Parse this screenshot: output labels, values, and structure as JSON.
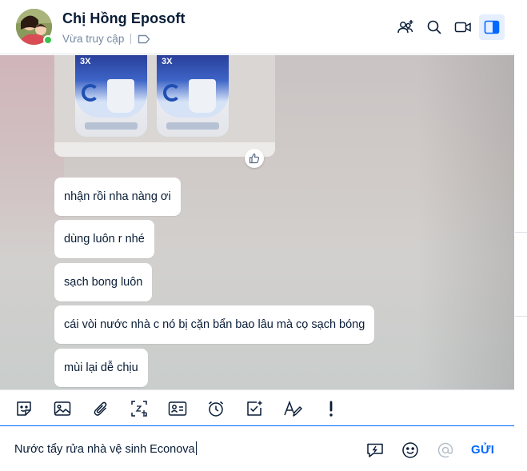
{
  "header": {
    "contact_name": "Chị Hồng Eposoft",
    "status": "Vừa truy cập",
    "icons": [
      "add-member-icon",
      "search-icon",
      "video-call-icon",
      "sidebar-toggle-icon"
    ]
  },
  "chat": {
    "image_message": {
      "bottle_badge": "3X"
    },
    "messages": [
      "nhận rồi nha nàng ơi",
      "dùng luôn r nhé",
      "sạch bong luôn",
      "cái vòi nước nhà c nó bị cặn bẩn bao lâu mà cọ sạch bóng",
      "mùi lại dễ chịu"
    ]
  },
  "toolbar": {
    "icons": [
      "sticker-icon",
      "image-icon",
      "attachment-icon",
      "screenshot-icon",
      "contact-card-icon",
      "reminder-icon",
      "task-icon",
      "text-format-icon",
      "important-icon"
    ]
  },
  "composer": {
    "value": "Nước tẩy rửa nhà vệ sinh Econova",
    "send_label": "GỬI"
  },
  "colors": {
    "accent": "#0068ff",
    "online": "#3bc24b",
    "text": "#081c36",
    "muted": "#7589a3"
  }
}
